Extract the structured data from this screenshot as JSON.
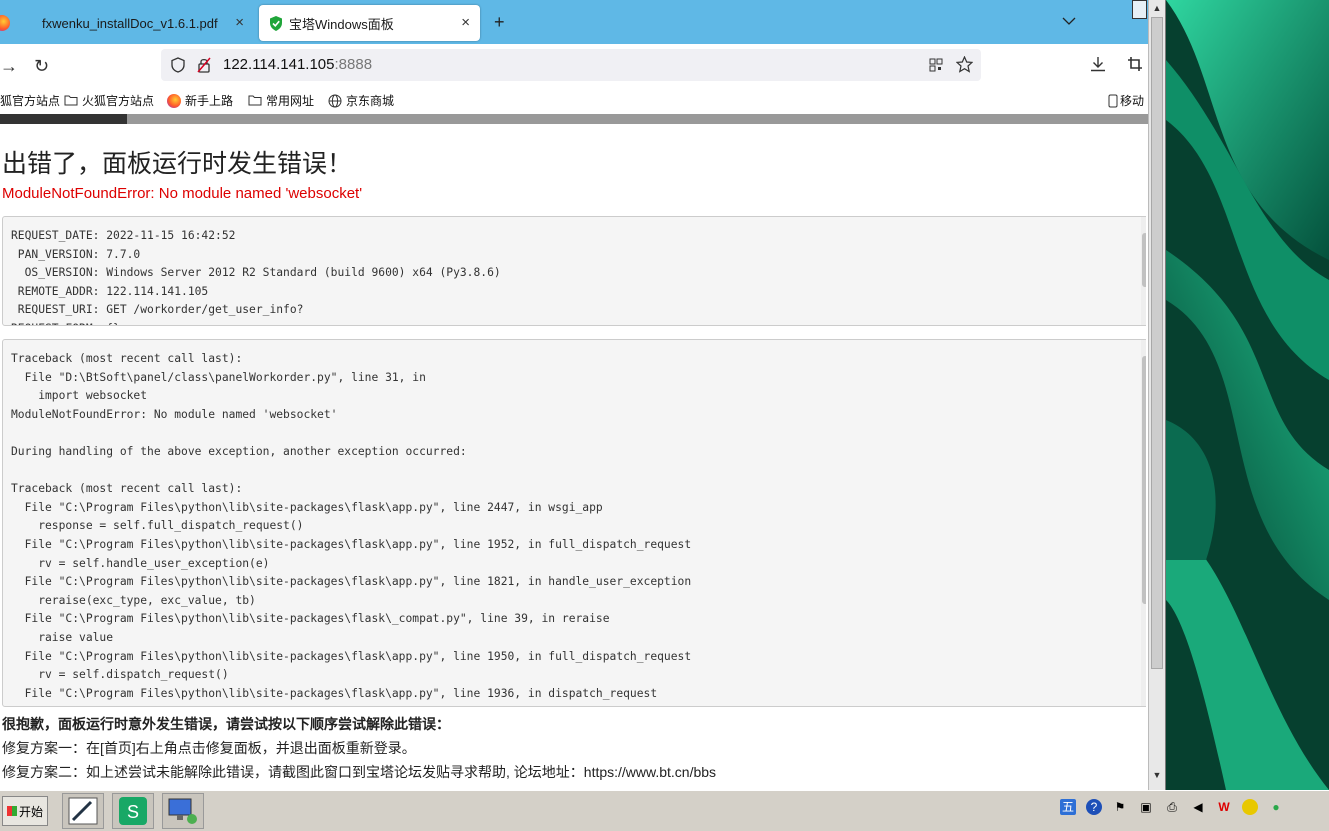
{
  "tabs": [
    {
      "title": "fxwenku_installDoc_v1.6.1.pdf",
      "close": "×"
    },
    {
      "title": "宝塔Windows面板",
      "close": "×"
    }
  ],
  "new_tab": "+",
  "toolbar": {
    "back": "→",
    "reload": "↻",
    "url_host": "122.114.141.105",
    "url_port": ":8888"
  },
  "bookmarks": [
    {
      "label": "狐官方站点",
      "icon": "folder-icon"
    },
    {
      "label": "火狐官方站点",
      "icon": "folder-icon"
    },
    {
      "label": "新手上路",
      "icon": "firefox-icon"
    },
    {
      "label": "常用网址",
      "icon": "folder-icon"
    },
    {
      "label": "京东商城",
      "icon": "globe-icon"
    }
  ],
  "mobile_bookmarks": "移动",
  "progress": 0.11,
  "error": {
    "title": "出错了，面板运行时发生错误！",
    "message": "ModuleNotFoundError: No module named 'websocket'"
  },
  "request_info": "REQUEST_DATE: 2022-11-15 16:42:52\n PAN_VERSION: 7.7.0\n  OS_VERSION: Windows Server 2012 R2 Standard (build 9600) x64 (Py3.8.6)\n REMOTE_ADDR: 122.114.141.105\n REQUEST_URI: GET /workorder/get_user_info?\nREQUEST_FORM: {}",
  "traceback": "Traceback (most recent call last):\n  File \"D:\\BtSoft\\panel/class\\panelWorkorder.py\", line 31, in\n    import websocket\nModuleNotFoundError: No module named 'websocket'\n\nDuring handling of the above exception, another exception occurred:\n\nTraceback (most recent call last):\n  File \"C:\\Program Files\\python\\lib\\site-packages\\flask\\app.py\", line 2447, in wsgi_app\n    response = self.full_dispatch_request()\n  File \"C:\\Program Files\\python\\lib\\site-packages\\flask\\app.py\", line 1952, in full_dispatch_request\n    rv = self.handle_user_exception(e)\n  File \"C:\\Program Files\\python\\lib\\site-packages\\flask\\app.py\", line 1821, in handle_user_exception\n    reraise(exc_type, exc_value, tb)\n  File \"C:\\Program Files\\python\\lib\\site-packages\\flask\\_compat.py\", line 39, in reraise\n    raise value\n  File \"C:\\Program Files\\python\\lib\\site-packages\\flask\\app.py\", line 1950, in full_dispatch_request\n    rv = self.dispatch_request()\n  File \"C:\\Program Files\\python\\lib\\site-packages\\flask\\app.py\", line 1936, in dispatch_request",
  "tips": {
    "heading": "很抱歉，面板运行时意外发生错误，请尝试按以下顺序尝试解除此错误：",
    "fix1": "修复方案一：在[首页]右上角点击修复面板，并退出面板重新登录。",
    "fix2": "修复方案二：如上述尝试未能解除此错误，请截图此窗口到宝塔论坛发贴寻求帮助, 论坛地址：https://www.bt.cn/bbs"
  },
  "taskbar": {
    "start_label": "开始",
    "tray_ime": "五"
  },
  "colors": {
    "tabstrip": "#5fb8e6",
    "error_red": "#dd0000",
    "desktop_green": "#0a6a4e"
  }
}
